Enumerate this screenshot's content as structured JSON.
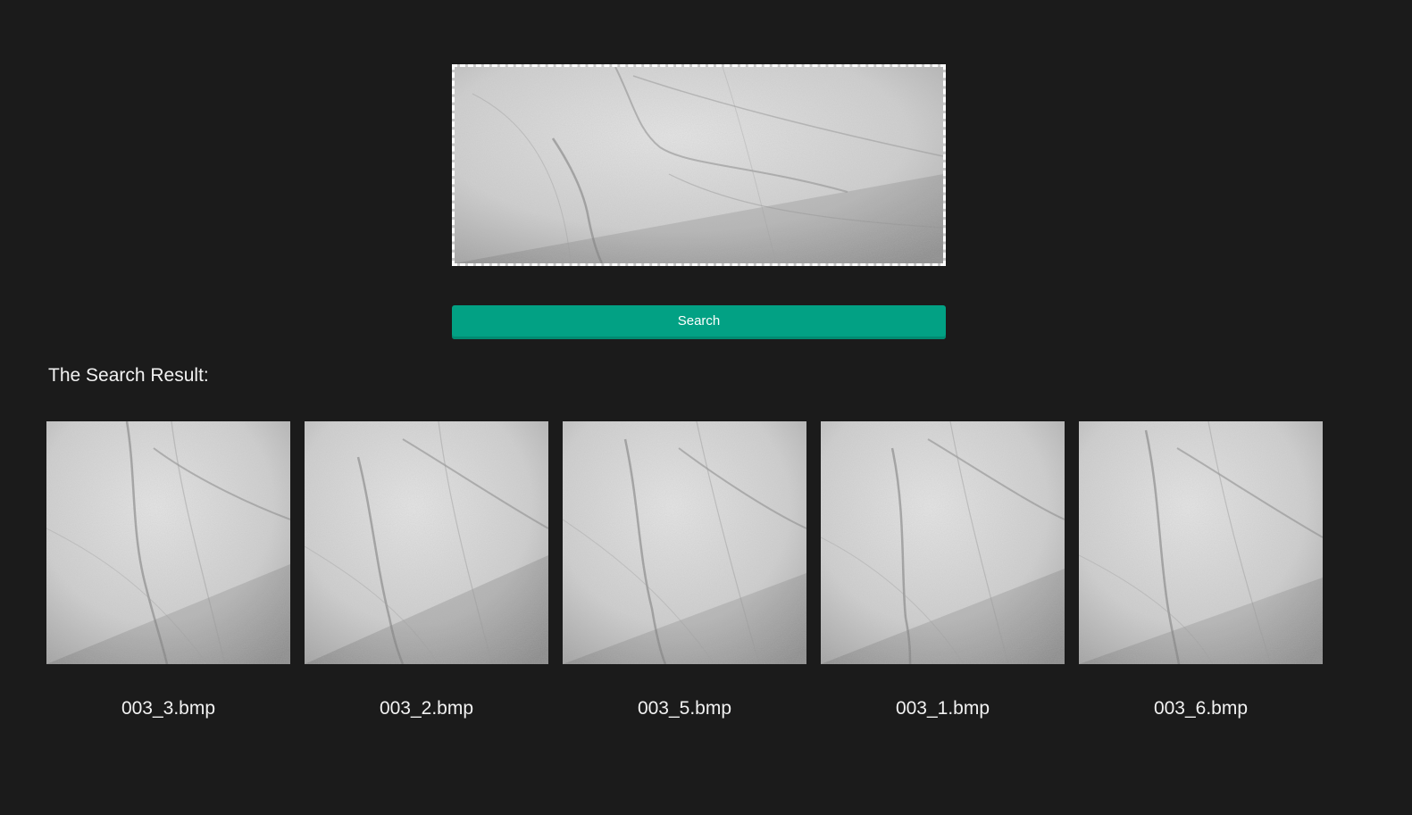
{
  "search": {
    "button_label": "Search"
  },
  "results": {
    "title": "The Search Result:",
    "items": [
      {
        "filename": "003_3.bmp"
      },
      {
        "filename": "003_2.bmp"
      },
      {
        "filename": "003_5.bmp"
      },
      {
        "filename": "003_1.bmp"
      },
      {
        "filename": "003_6.bmp"
      }
    ]
  },
  "colors": {
    "background": "#1b1b1b",
    "button": "#02a184",
    "text": "#f2f2f2"
  }
}
